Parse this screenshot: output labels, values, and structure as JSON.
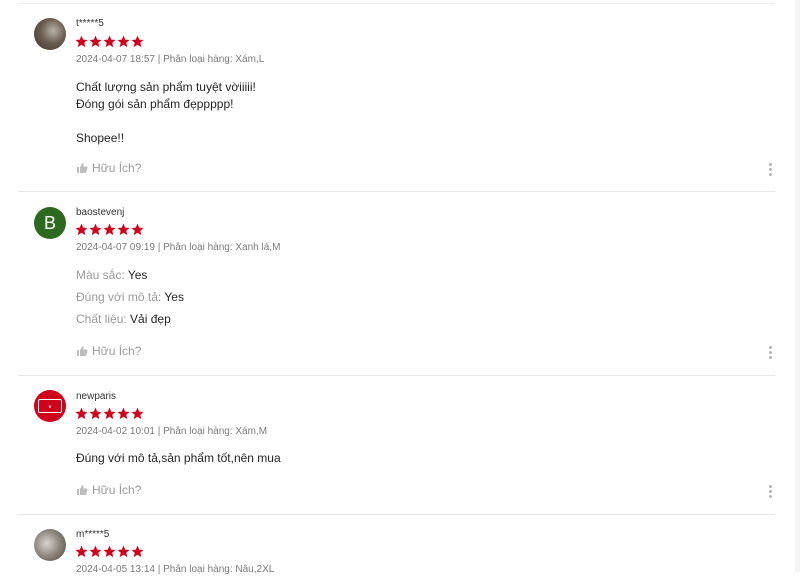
{
  "helpful_label": "Hữu Ích?",
  "star_color": "#d0011b",
  "reviews": [
    {
      "username": "t*****5",
      "rating": 5,
      "meta": "2024-04-07 18:57 | Phân loại hàng: Xám,L",
      "content": [
        "Chất lượng sản phẩm tuyệt vờiiiii!",
        "Đóng gói sản phẩm đẹppppp!",
        "",
        "Shopee!!"
      ]
    },
    {
      "username": "baostevenj",
      "avatar_letter": "B",
      "rating": 5,
      "meta": "2024-04-07 09:19 | Phân loại hàng: Xanh lá,M",
      "attributes": [
        {
          "key": "Màu sắc:",
          "value": "Yes"
        },
        {
          "key": "Đúng với mô tả:",
          "value": "Yes"
        },
        {
          "key": "Chất liệu:",
          "value": "Vải đẹp"
        }
      ]
    },
    {
      "username": "newparis",
      "rating": 5,
      "meta": "2024-04-02 10:01 | Phân loại hàng: Xám,M",
      "content": [
        "Đúng với mô tả,sản phẩm tốt,nên mua"
      ]
    },
    {
      "username": "m*****5",
      "rating": 5,
      "meta": "2024-04-05 13:14 | Phân loại hàng: Nâu,2XL"
    }
  ]
}
